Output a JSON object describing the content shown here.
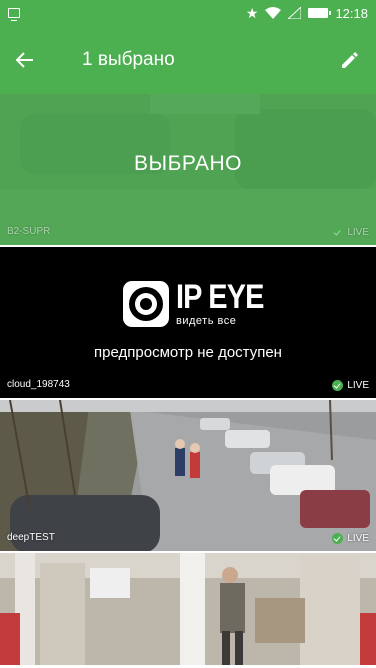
{
  "status_bar": {
    "time": "12:18"
  },
  "app_bar": {
    "title": "1 выбрано"
  },
  "cameras": [
    {
      "name": "B2-SUPR",
      "live": "LIVE",
      "selected_label": "ВЫБРАНО"
    },
    {
      "name": "cloud_198743",
      "live": "LIVE",
      "logo_title": "IP EYE",
      "logo_subtitle": "видеть все",
      "no_preview": "предпросмотр не доступен"
    },
    {
      "name": "deepTEST",
      "live": "LIVE"
    },
    {
      "name": "",
      "live": ""
    }
  ],
  "colors": {
    "accent": "#4caf50",
    "status_bar": "#4caf50"
  }
}
